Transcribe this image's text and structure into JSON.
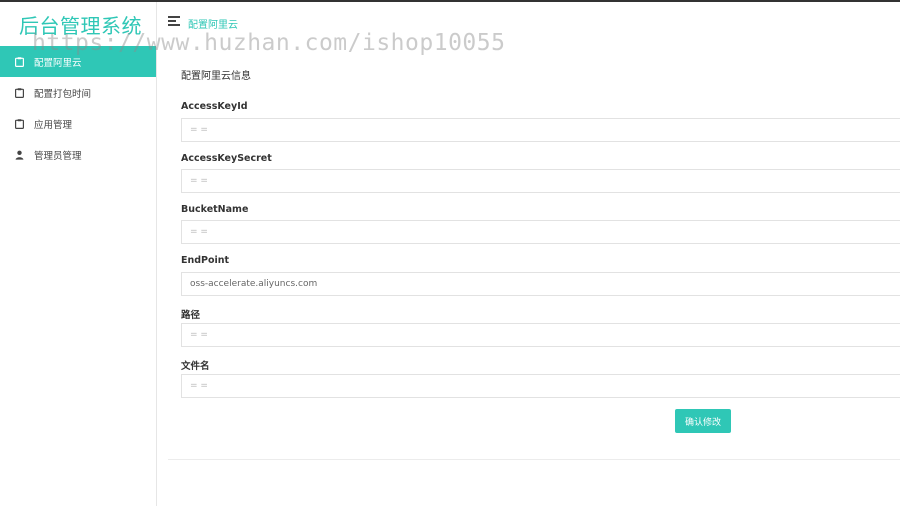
{
  "app": {
    "title": "后台管理系统"
  },
  "header": {
    "breadcrumb": "配置阿里云"
  },
  "watermark": "https://www.huzhan.com/ishop10055",
  "sidebar": {
    "items": [
      {
        "label": "配置阿里云",
        "icon": "clipboard-icon",
        "active": true
      },
      {
        "label": "配置打包时间",
        "icon": "clipboard-icon",
        "active": false
      },
      {
        "label": "应用管理",
        "icon": "clipboard-icon",
        "active": false
      },
      {
        "label": "管理员管理",
        "icon": "user-icon",
        "active": false
      }
    ]
  },
  "form": {
    "title": "配置阿里云信息",
    "fields": [
      {
        "label": "AccessKeyId",
        "value": "",
        "placeholder": "= ="
      },
      {
        "label": "AccessKeySecret",
        "value": "",
        "placeholder": "= ="
      },
      {
        "label": "BucketName",
        "value": "",
        "placeholder": "= ="
      },
      {
        "label": "EndPoint",
        "value": "oss-accelerate.aliyuncs.com",
        "placeholder": ""
      },
      {
        "label": "路径",
        "value": "",
        "placeholder": "= ="
      },
      {
        "label": "文件名",
        "value": "",
        "placeholder": "= ="
      }
    ],
    "submit_label": "确认修改"
  },
  "colors": {
    "accent": "#2fc7b6",
    "text": "#333333",
    "border": "#e2e2e2"
  }
}
